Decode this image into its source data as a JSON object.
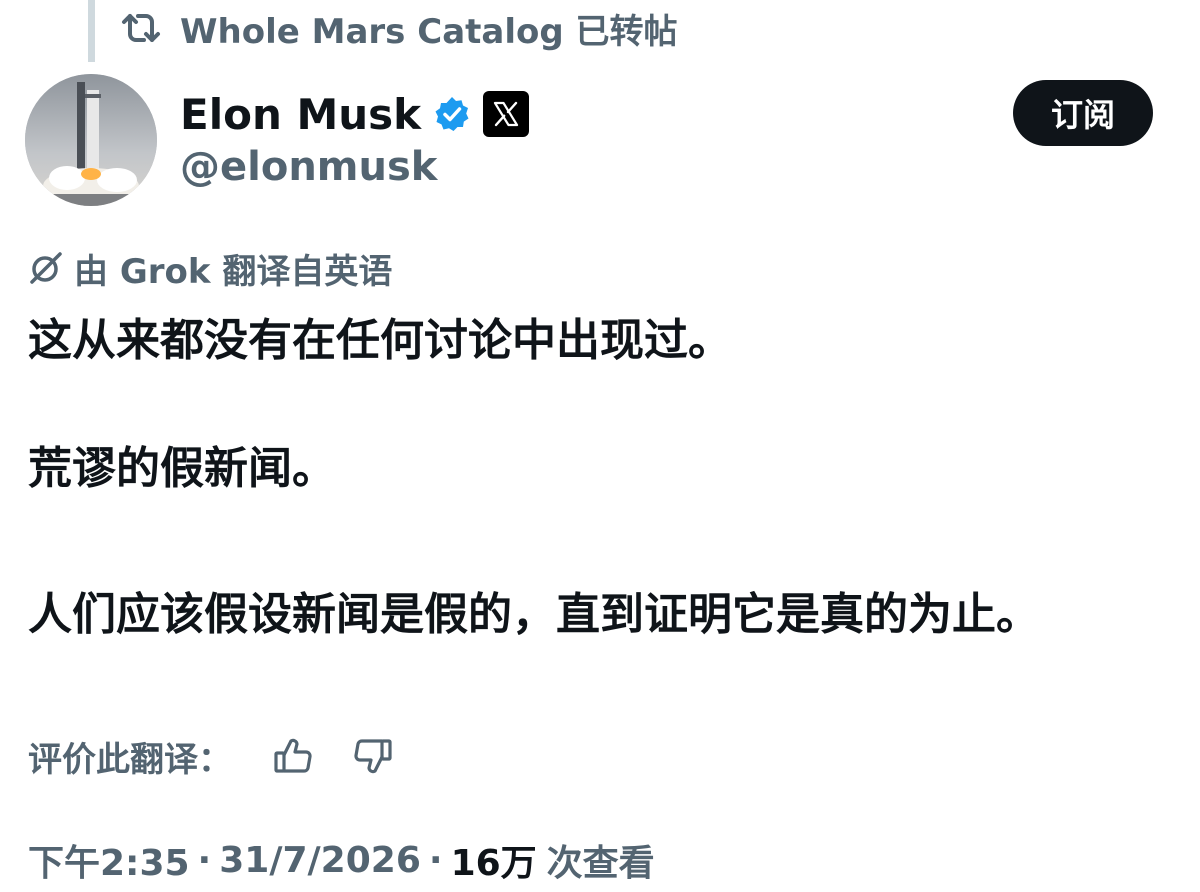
{
  "repost": {
    "icon": "repost-icon",
    "text": "Whole Mars Catalog 已转帖"
  },
  "author": {
    "avatar": "avatar-rocket-launch",
    "name": "Elon Musk",
    "verified_icon": "verified-badge-icon",
    "affiliate_icon": "x-logo-icon",
    "handle": "@elonmusk"
  },
  "subscribe_label": "订阅",
  "translation": {
    "icon": "grok-icon",
    "label": "由 Grok 翻译自英语"
  },
  "tweet": {
    "paragraphs": [
      "这从来都没有在任何讨论中出现过。",
      "荒谬的假新闻。",
      "人们应该假设新闻是假的，直到证明它是真的为止。"
    ]
  },
  "rate": {
    "label": "评价此翻译：",
    "up_icon": "thumbs-up-icon",
    "down_icon": "thumbs-down-icon"
  },
  "meta": {
    "time": "下午2:35",
    "separator": "·",
    "date": "31/7/2026",
    "views": "16万",
    "views_label": "次查看"
  },
  "colors": {
    "text_primary": "#0f1419",
    "text_secondary": "#536471",
    "verified_blue": "#1d9bf0",
    "button_bg": "#0f1419"
  }
}
